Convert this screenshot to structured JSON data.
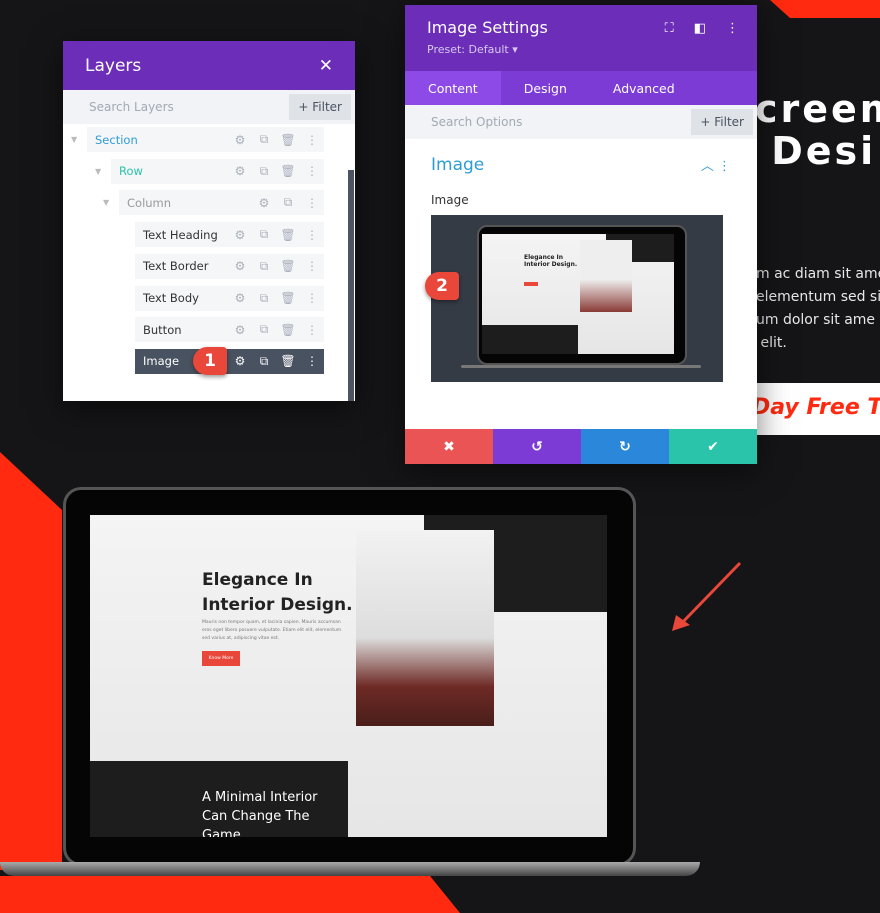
{
  "colors": {
    "background": "#151517",
    "accent_red": "#ff2a10",
    "purple": "#6c2eb9",
    "cancel": "#ea5455",
    "undo": "#7d3bd6",
    "redo": "#2b87da",
    "save": "#29c4a9"
  },
  "hero": {
    "heading": "creem\n Desi",
    "paragraph": "m ac diam sit ame\nelementum sed sit\num dolor sit ame\n elit.",
    "banner": "Day Free T"
  },
  "layers": {
    "title": "Layers",
    "close_icon": "close-icon",
    "search_placeholder": "Search Layers",
    "filter_label": "+ Filter",
    "items": [
      {
        "label": "Section",
        "color": "#2e9cd6"
      },
      {
        "label": "Row",
        "color": "#29c4a9"
      },
      {
        "label": "Column",
        "color": "#999"
      },
      {
        "label": "Text Heading"
      },
      {
        "label": "Text Border"
      },
      {
        "label": "Text Body"
      },
      {
        "label": "Button"
      },
      {
        "label": "Image",
        "selected": true
      }
    ],
    "badge": "1"
  },
  "settings": {
    "title": "Image Settings",
    "preset": "Preset: Default ▾",
    "tabs": [
      "Content",
      "Design",
      "Advanced"
    ],
    "active_tab": "Content",
    "search_placeholder": "Search Options",
    "filter_label": "+ Filter",
    "section_title": "Image",
    "field_label": "Image",
    "badge": "2"
  },
  "mockup": {
    "heading": "Elegance In\nInterior Design.",
    "body": "Mauris non tempor quam, et lacinia sapien. Mauris accumsan eros eget libero posuere vulputate. Etiam elit elit, elementum sed varius at, adipiscing vitae est.",
    "button": "Know More",
    "caption": "A Minimal Interior\nCan Change The\nGame."
  }
}
